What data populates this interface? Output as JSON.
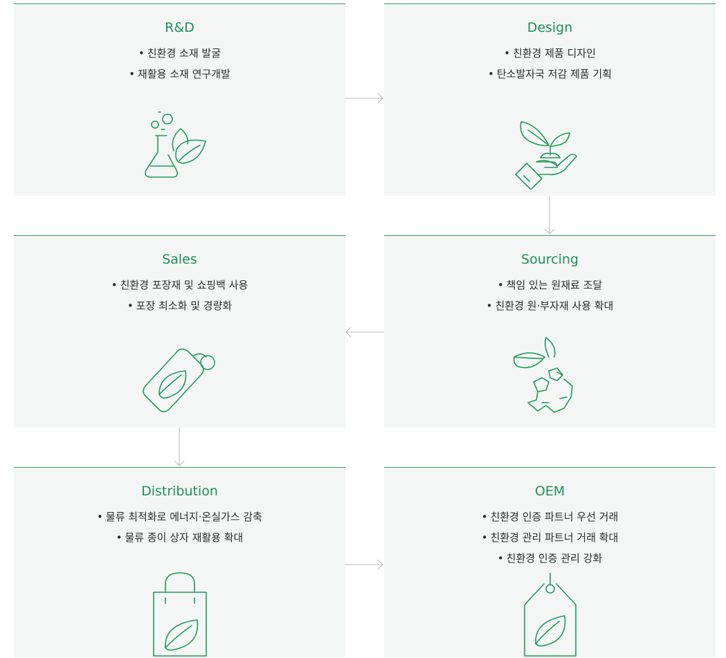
{
  "steps": [
    {
      "title": "R&D",
      "items": [
        "친환경 소재 발굴",
        "재활용 소재 연구개발"
      ],
      "icon": "flask-leaf-icon"
    },
    {
      "title": "Design",
      "items": [
        "친환경 제품 디자인",
        "탄소발자국 저감 제품 기획"
      ],
      "icon": "hand-sprout-icon"
    },
    {
      "title": "Sales",
      "items": [
        "친환경 포장재 및 쇼핑백 사용",
        "포장 최소화 및 경량화"
      ],
      "icon": "tag-leaf-icon"
    },
    {
      "title": "Sourcing",
      "items": [
        "책임 있는 원재료 조달",
        "친환경 원·부자재 사용 확대"
      ],
      "icon": "recycle-leaf-icon"
    },
    {
      "title": "Distribution",
      "items": [
        "물류 최적화로 에너지·온실가스 감축",
        "물류 종이 상자 재활용 확대"
      ],
      "icon": "shopping-bag-leaf-icon"
    },
    {
      "title": "OEM",
      "items": [
        "친환경 인증 파트너 우선 거래",
        "친환경 관리 파트너 거래 확대",
        "친환경 인증 관리 강화"
      ],
      "icon": "label-leaf-icon"
    }
  ],
  "colors": {
    "accent": "#1f9a5b",
    "card_bg": "#f3f6f4",
    "arrow": "#b8b8b8"
  }
}
